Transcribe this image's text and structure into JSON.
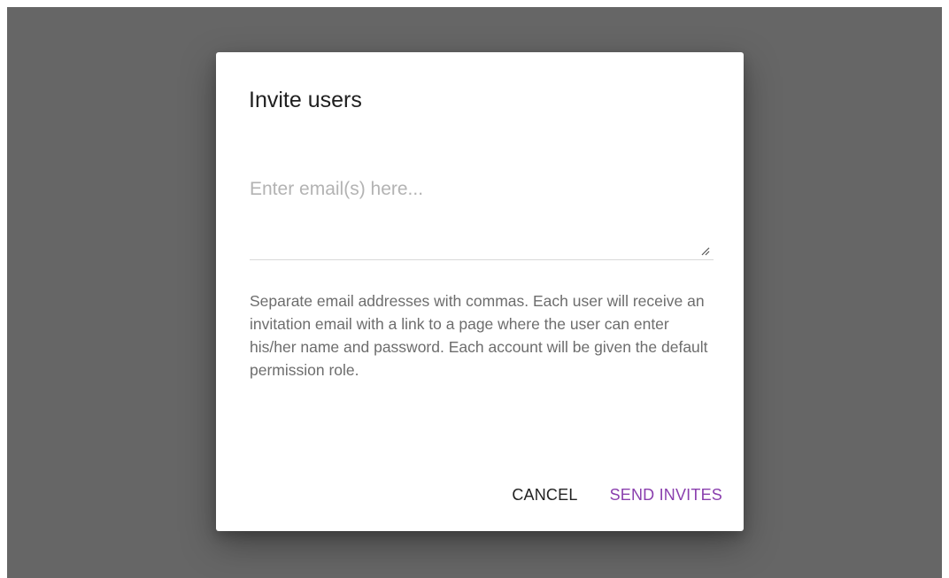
{
  "dialog": {
    "title": "Invite users",
    "email_field": {
      "placeholder": "Enter email(s) here...",
      "value": ""
    },
    "help_text": "Separate email addresses with commas. Each user will receive an invitation email with a link to a page where the user can enter his/her name and password. Each account will be given the default permission role.",
    "actions": {
      "cancel_label": "CANCEL",
      "send_label": "SEND INVITES"
    }
  },
  "colors": {
    "backdrop": "#666666",
    "accent": "#8a3fae"
  },
  "icons": {
    "resize": "resize-handle-icon"
  }
}
